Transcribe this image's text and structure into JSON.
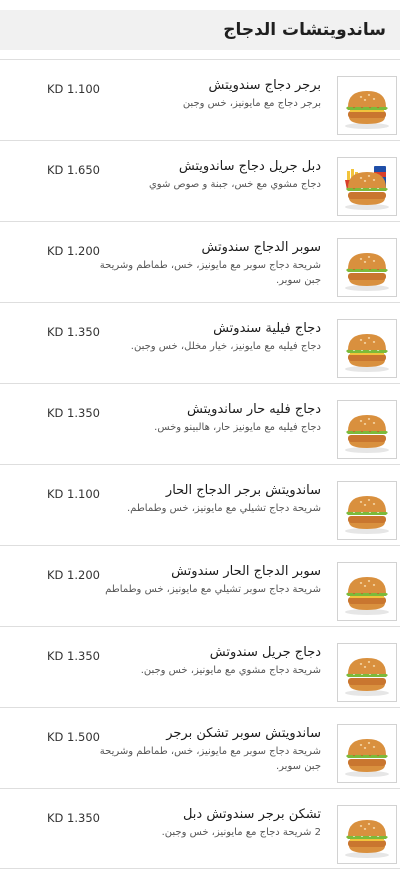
{
  "header": {
    "title": "ساندويتشات الدجاج"
  },
  "menu_items": [
    {
      "name": "برجر دجاج سندويتش",
      "description": "برجر دجاج مع مايونيز، خس وجبن",
      "price": "KD 1.100",
      "image": "chicken-burger"
    },
    {
      "name": "دبل جريل دجاج ساندويتش",
      "description": "دجاج مشوي مع خس، جبنة و صوص شوي",
      "price": "KD 1.650",
      "image": "grilled-chicken-combo"
    },
    {
      "name": "سوبر الدجاج سندوتش",
      "description": "شريحة دجاج سوبر مع مايونيز، خس، طماطم وشريحة جبن سوبر.",
      "price": "KD 1.200",
      "image": "super-chicken-burger"
    },
    {
      "name": "دجاج فيلية سندوتش",
      "description": "دجاج فيليه مع مايونيز، خيار مخلل، خس وجبن.",
      "price": "KD 1.350",
      "image": "chicken-fillet-burger"
    },
    {
      "name": "دجاج فليه حار ساندويتش",
      "description": "دجاج فيليه مع مايونيز حار، هالبينو وخس.",
      "price": "KD 1.350",
      "image": "spicy-fillet-burger"
    },
    {
      "name": "ساندويتش برجر الدجاج الحار",
      "description": "شريحة دجاج تشيلي مع مايونيز، خس وطماطم.",
      "price": "KD 1.100",
      "image": "spicy-chicken-burger"
    },
    {
      "name": "سوبر الدجاج الحار سندوتش",
      "description": "شريحة دجاج سوبر تشيلي مع مايونيز، خس وطماطم",
      "price": "KD 1.200",
      "image": "super-spicy-chicken-burger"
    },
    {
      "name": "دجاج جريل سندوتش",
      "description": "شريحة دجاج مشوي مع مايونيز، خس وجبن.",
      "price": "KD 1.350",
      "image": "grilled-chicken-burger"
    },
    {
      "name": "ساندويتش سوبر تشكن برجر",
      "description": "شريحة دجاج سوبر مع مايونيز، خس، طماطم وشريحة جبن سوبر.",
      "price": "KD 1.500",
      "image": "super-chicken-burger-2"
    },
    {
      "name": "تشكن برجر سندوتش دبل",
      "description": "2 شريحة دجاج مع مايونيز، خس وجبن.",
      "price": "KD 1.350",
      "image": "double-chicken-burger"
    }
  ],
  "colors": {
    "header_bg": "#f1f1f1",
    "divider": "#dedede",
    "bun": "#d9903e",
    "lettuce": "#7cba3a",
    "patty": "#c9762f",
    "tomato": "#d9402b",
    "cheese": "#f2c43c"
  }
}
